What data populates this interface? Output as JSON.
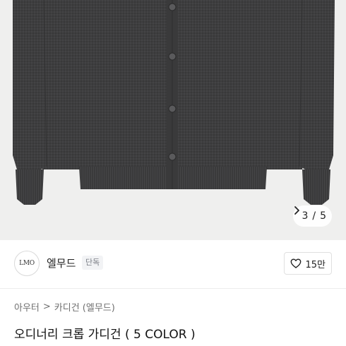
{
  "gallery": {
    "current": "3",
    "separator": "/",
    "total": "5",
    "next_icon": "chevron-right-icon"
  },
  "shop": {
    "logo_text": "LMO",
    "name": "엘무드",
    "badge": "단독",
    "like_icon": "heart-outline-icon",
    "like_count": "15만"
  },
  "breadcrumb": {
    "level1": "아우터",
    "separator": ">",
    "level2": "카디건 (엘무드)"
  },
  "product": {
    "title": "오디너리 크롭 가디건 ( 5 COLOR )"
  }
}
